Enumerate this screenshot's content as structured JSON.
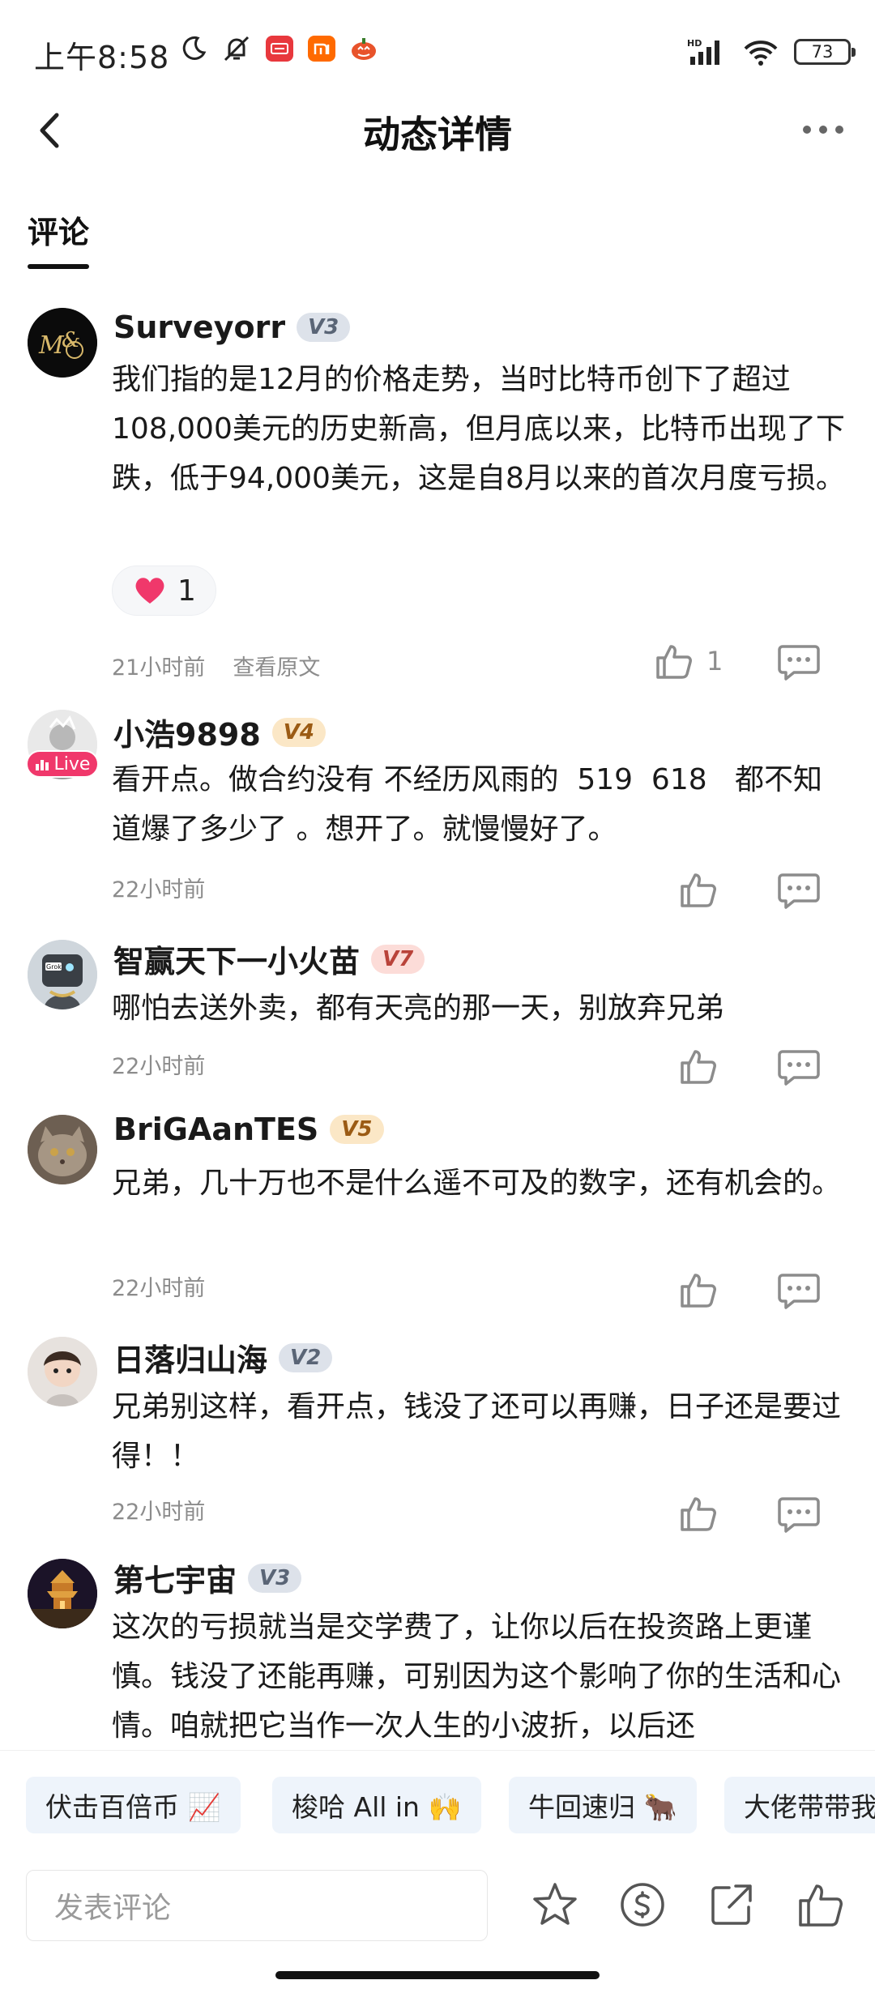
{
  "status_bar": {
    "time": "上午8:58",
    "battery": "73",
    "network_label": "HD"
  },
  "header": {
    "title": "动态详情"
  },
  "tabs": [
    {
      "label": "评论",
      "active": true
    }
  ],
  "comments": [
    {
      "user": "Surveyorr",
      "level": "V3",
      "text": "我们指的是12月的价格走势，当时比特币创下了超过108,000美元的历史新高，但月底以来，比特币出现了下跌，低于94,000美元，这是自8月以来的首次月度亏损。",
      "reaction_count": "1",
      "time": "21小时前",
      "view_original": "查看原文",
      "like_count": "1"
    },
    {
      "user": "小浩9898",
      "level": "V4",
      "live_label": "Live",
      "text": "看开点。做合约没有 不经历风雨的  519  618   都不知道爆了多少了 。想开了。就慢慢好了。",
      "time": "22小时前"
    },
    {
      "user": "智赢天下一小火苗",
      "level": "V7",
      "text": "哪怕去送外卖，都有天亮的那一天，别放弃兄弟",
      "time": "22小时前"
    },
    {
      "user": "BriGAanTES",
      "level": "V5",
      "text": "兄弟，几十万也不是什么遥不可及的数字，还有机会的。",
      "time": "22小时前"
    },
    {
      "user": "日落归山海",
      "level": "V2",
      "text": "兄弟别这样，看开点，钱没了还可以再赚，日子还是要过得！！",
      "time": "22小时前"
    },
    {
      "user": "第七宇宙",
      "level": "V3",
      "text": "这次的亏损就当是交学费了，让你以后在投资路上更谨慎。钱没了还能再赚，可别因为这个影响了你的生活和心情。咱就把它当作一次人生的小波折，以后还"
    }
  ],
  "quick_replies": [
    {
      "label": "伏击百倍币 📈"
    },
    {
      "label": "梭哈 All in 🙌"
    },
    {
      "label": "牛回速归 🐂"
    },
    {
      "label": "大佬带带我"
    }
  ],
  "bottom_bar": {
    "input_placeholder": "发表评论"
  },
  "colors": {
    "live_badge": "#f0386b",
    "heart": "#f0386b",
    "chip_bg": "#eef4fb",
    "meta_text": "#8c8c8c"
  }
}
